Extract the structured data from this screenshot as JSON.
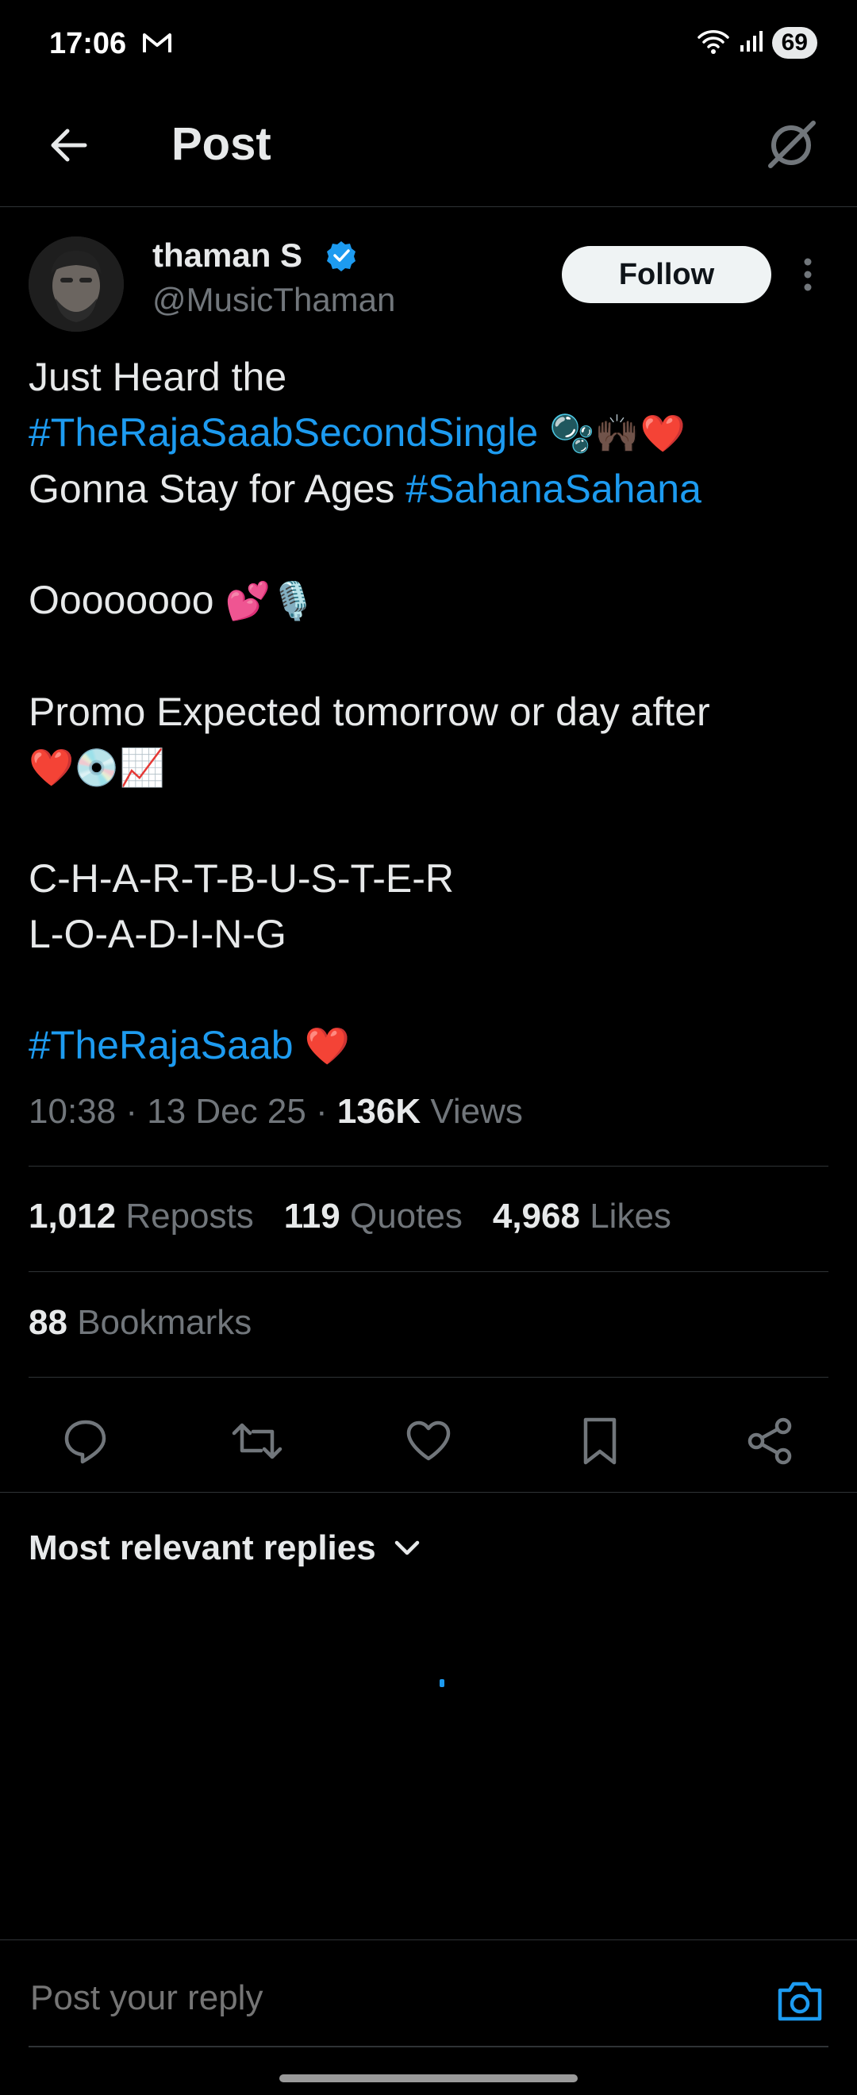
{
  "status_bar": {
    "time": "17:06",
    "battery": "69"
  },
  "header": {
    "title": "Post"
  },
  "author": {
    "name": "thaman S",
    "handle": "@MusicThaman"
  },
  "follow_label": "Follow",
  "post": {
    "l1": "Just Heard the",
    "l2_tag": "#TheRajaSaabSecondSingle",
    "l2_emoji": "🫧🙌🏿❤️",
    "l3_text": "Gonna Stay for Ages ",
    "l3_tag": "#SahanaSahana",
    "l4_text": "Oooooooo ",
    "l4_emoji": "💕🎙️",
    "l5": "Promo Expected tomorrow or day after",
    "l6_emoji": "❤️💿📈",
    "l7": "C-H-A-R-T-B-U-S-T-E-R",
    "l8": "L-O-A-D-I-N-G",
    "l9_tag": "#TheRajaSaab",
    "l9_emoji": "❤️"
  },
  "meta": {
    "time": "10:38",
    "date": "13 Dec 25",
    "views_count": "136K",
    "views_label": "Views"
  },
  "stats": {
    "reposts_count": "1,012",
    "reposts_label": "Reposts",
    "quotes_count": "119",
    "quotes_label": "Quotes",
    "likes_count": "4,968",
    "likes_label": "Likes",
    "bookmarks_count": "88",
    "bookmarks_label": "Bookmarks"
  },
  "replies": {
    "sort_label": "Most relevant replies"
  },
  "composer": {
    "placeholder": "Post your reply"
  },
  "colors": {
    "accent": "#1d9bf0",
    "background": "#000000",
    "text": "#e7e9ea",
    "muted": "#71767b",
    "divider": "#2f3336"
  },
  "icons": [
    "back-arrow-icon",
    "grok-icon",
    "verified-icon",
    "more-vertical-icon",
    "reply-icon",
    "repost-icon",
    "like-icon",
    "bookmark-icon",
    "share-icon",
    "chevron-down-icon",
    "camera-icon"
  ]
}
